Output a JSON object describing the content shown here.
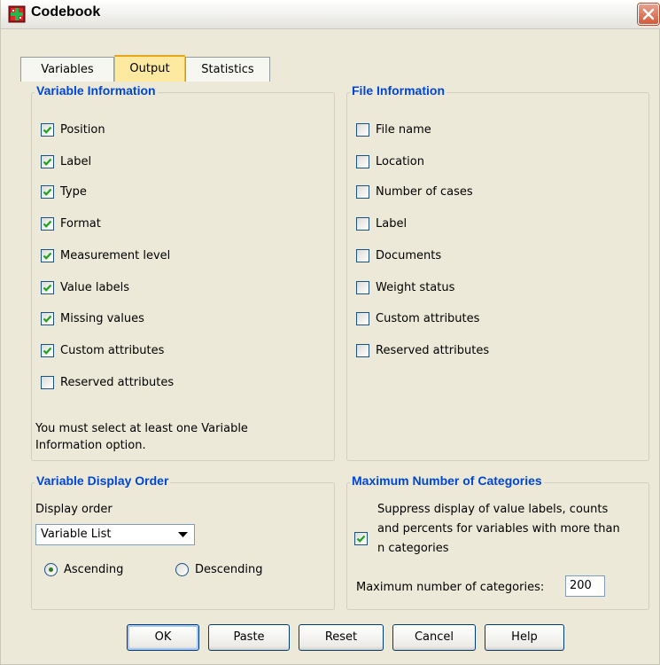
{
  "window": {
    "title": "Codebook"
  },
  "tabs": [
    {
      "label": "Variables",
      "active": false
    },
    {
      "label": "Output",
      "active": true
    },
    {
      "label": "Statistics",
      "active": false
    }
  ],
  "variable_information": {
    "title": "Variable Information",
    "items": [
      {
        "label": "Position",
        "checked": true
      },
      {
        "label": "Label",
        "checked": true
      },
      {
        "label": "Type",
        "checked": true
      },
      {
        "label": "Format",
        "checked": true
      },
      {
        "label": "Measurement level",
        "checked": true
      },
      {
        "label": "Value labels",
        "checked": true
      },
      {
        "label": "Missing values",
        "checked": true
      },
      {
        "label": "Custom attributes",
        "checked": true
      },
      {
        "label": "Reserved attributes",
        "checked": false
      }
    ],
    "note_line1": "You must select at least one Variable",
    "note_line2": "Information option."
  },
  "file_information": {
    "title": "File Information",
    "items": [
      {
        "label": "File name",
        "checked": false
      },
      {
        "label": "Location",
        "checked": false
      },
      {
        "label": "Number of cases",
        "checked": false
      },
      {
        "label": "Label",
        "checked": false
      },
      {
        "label": "Documents",
        "checked": false
      },
      {
        "label": "Weight status",
        "checked": false
      },
      {
        "label": "Custom attributes",
        "checked": false
      },
      {
        "label": "Reserved attributes",
        "checked": false
      }
    ]
  },
  "variable_display_order": {
    "title": "Variable Display Order",
    "display_order_label": "Display order",
    "selected": "Variable List",
    "ascending_label": "Ascending",
    "descending_label": "Descending",
    "ascending_selected": true
  },
  "max_categories": {
    "title": "Maximum Number of Categories",
    "suppress_line1": "Suppress display of value labels, counts",
    "suppress_line2": "and percents for variables with more than",
    "suppress_line3": "n categories",
    "suppress_checked": true,
    "max_label": "Maximum number of categories:",
    "max_value": "200"
  },
  "buttons": {
    "ok": "OK",
    "paste": "Paste",
    "reset": "Reset",
    "cancel": "Cancel",
    "help": "Help"
  },
  "colors": {
    "group_title": "#0046d5",
    "active_tab": "#fde9a0",
    "dialog_bg": "#ece9d8"
  }
}
